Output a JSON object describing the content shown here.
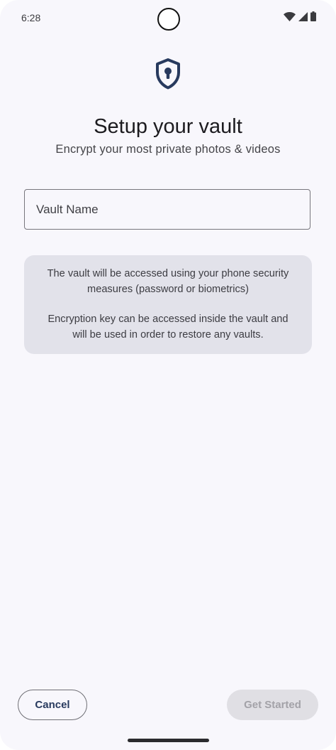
{
  "status_bar": {
    "time": "6:28",
    "icons": [
      "wifi-icon",
      "cellular-signal-icon",
      "battery-icon"
    ]
  },
  "header": {
    "icon": "shield-keyhole-icon",
    "title": "Setup your vault",
    "subtitle": "Encrypt your most private photos & videos"
  },
  "form": {
    "vault_name": {
      "value": "",
      "placeholder": "Vault Name"
    }
  },
  "info": {
    "paragraph1": "The vault will be accessed using your phone security measures (password or biometrics)",
    "paragraph2": "Encryption key can be accessed inside the vault and will be used in order to restore any vaults."
  },
  "actions": {
    "cancel_label": "Cancel",
    "get_started_label": "Get Started",
    "get_started_enabled": false
  },
  "colors": {
    "accent": "#283a5e",
    "background": "#f8f7fc",
    "card": "#e2e2ea",
    "disabled_button": "#e0dfe4"
  }
}
